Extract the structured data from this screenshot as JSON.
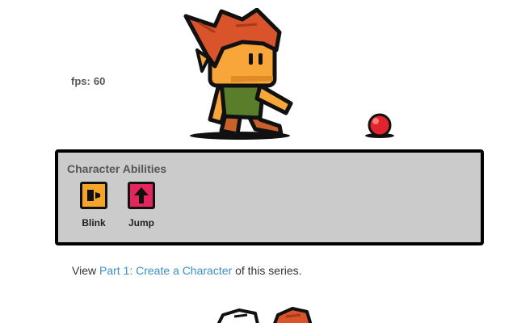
{
  "hud": {
    "fps_label": "fps:",
    "fps_value": "60"
  },
  "abilities": {
    "title": "Character Abilities",
    "items": [
      {
        "label": "Blink",
        "icon": "blink-icon",
        "color": "#f5a52a"
      },
      {
        "label": "Jump",
        "icon": "jump-arrow-icon",
        "color": "#e4265d"
      }
    ]
  },
  "series_note": {
    "prefix": "View",
    "link_text": "Part 1: Create a Character",
    "suffix": "of this series."
  },
  "colors": {
    "panel_background": "#cbcbcb",
    "link": "#3a8fc7",
    "hero_hair": "#d9532b",
    "hero_skin": "#f8a53a",
    "hero_shirt": "#5a7d2c",
    "ball": "#e0262c"
  }
}
